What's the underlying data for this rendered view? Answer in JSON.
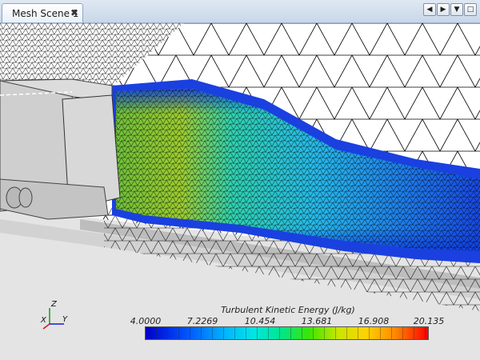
{
  "tab": {
    "label": "Mesh Scene 1",
    "close_glyph": "✖"
  },
  "window_buttons": {
    "prev_glyph": "◀",
    "next_glyph": "▶",
    "menu_glyph": "▼",
    "maximize_glyph": "□"
  },
  "colorbar": {
    "title": "Turbulent Kinetic Energy (J/kg)",
    "ticks": [
      "4.0000",
      "7.2269",
      "10.454",
      "13.681",
      "16.908",
      "20.135"
    ]
  },
  "axes": {
    "z": "Z",
    "x": "X",
    "y": "Y"
  },
  "colors": {
    "accent_blue": "#0000c8",
    "hot_red": "#ff0000",
    "mesh_line": "#000000",
    "vehicle_grey": "#cfcfcf"
  }
}
